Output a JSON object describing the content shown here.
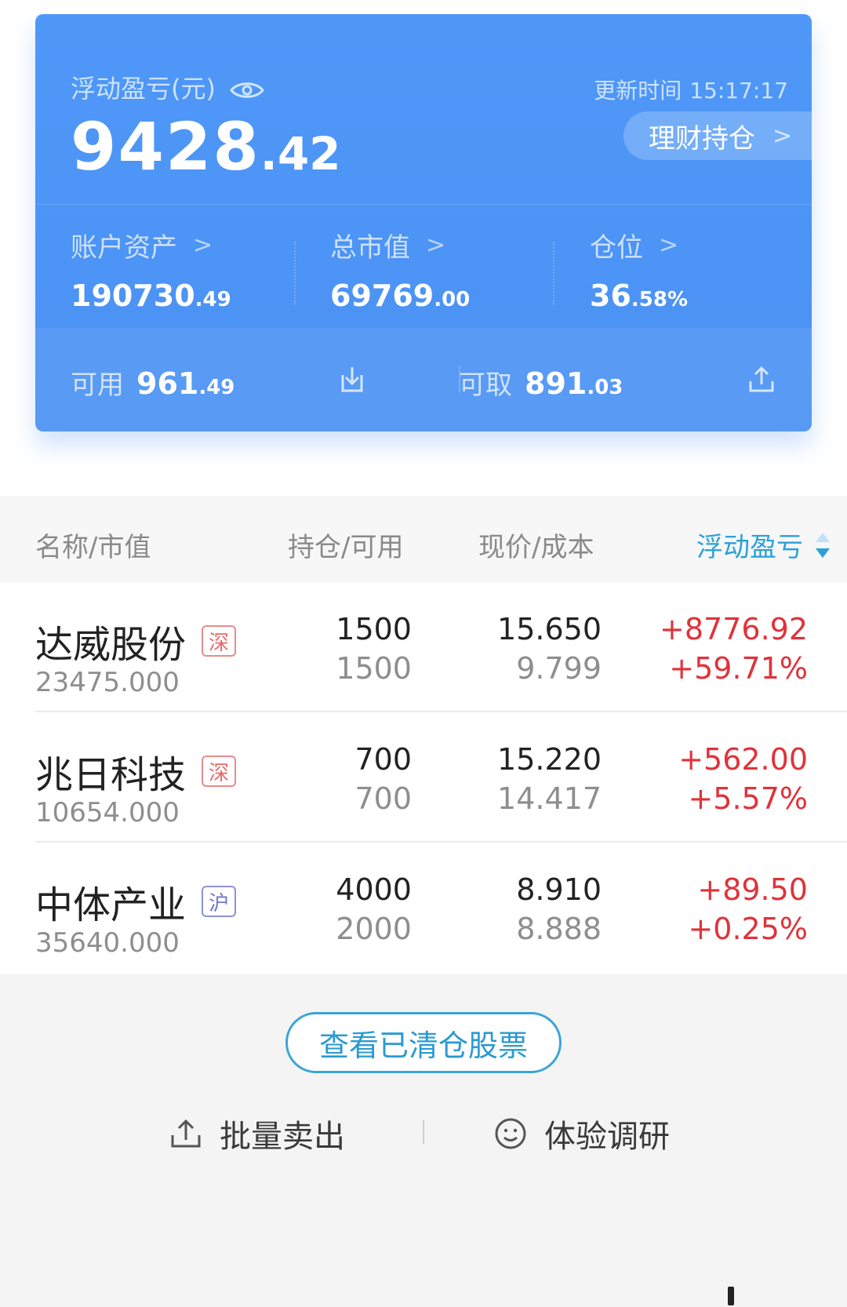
{
  "card": {
    "pnl_label": "浮动盈亏(元)",
    "update_label": "更新时间",
    "update_time": "15:17:17",
    "pnl_int": "9428",
    "pnl_dec": ".42",
    "wealth_button": "理财持仓",
    "stats": [
      {
        "label": "账户资产",
        "int": "190730",
        "dec": ".49"
      },
      {
        "label": "总市值",
        "int": "69769",
        "dec": ".00"
      },
      {
        "label": "仓位",
        "int": "36",
        "dec": ".58%"
      }
    ],
    "available": {
      "label": "可用",
      "int": "961",
      "dec": ".49"
    },
    "withdrawable": {
      "label": "可取",
      "int": "891",
      "dec": ".03"
    }
  },
  "table": {
    "headers": [
      "名称/市值",
      "持仓/可用",
      "现价/成本",
      "浮动盈亏"
    ],
    "rows": [
      {
        "name": "达威股份",
        "market": "深",
        "market_value": "23475.000",
        "holding": "1500",
        "available": "1500",
        "price": "15.650",
        "cost": "9.799",
        "pnl": "+8776.92",
        "pnl_pct": "+59.71%"
      },
      {
        "name": "兆日科技",
        "market": "深",
        "market_value": "10654.000",
        "holding": "700",
        "available": "700",
        "price": "15.220",
        "cost": "14.417",
        "pnl": "+562.00",
        "pnl_pct": "+5.57%"
      },
      {
        "name": "中体产业",
        "market": "沪",
        "market_value": "35640.000",
        "holding": "4000",
        "available": "2000",
        "price": "8.910",
        "cost": "8.888",
        "pnl": "+89.50",
        "pnl_pct": "+0.25%"
      }
    ]
  },
  "footer": {
    "cleared_button": "查看已清仓股票",
    "batch_sell": "批量卖出",
    "survey": "体验调研"
  },
  "colors": {
    "card_blue": "#4a91f3",
    "profit_red": "#e0323a",
    "accent_cyan": "#2aa1d8"
  },
  "icons": [
    "eye-icon",
    "chevron-right-icon",
    "download-icon",
    "upload-icon",
    "sort-icon",
    "smile-icon"
  ]
}
